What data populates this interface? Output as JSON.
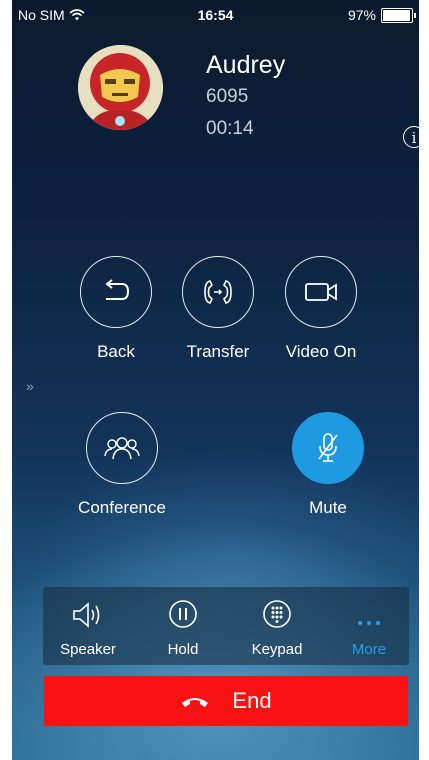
{
  "status_bar": {
    "carrier": "No SIM",
    "time": "16:54",
    "battery": "97%",
    "battery_level": 0.97
  },
  "caller": {
    "name": "Audrey",
    "number": "6095",
    "duration": "00:14"
  },
  "controls": {
    "back": "Back",
    "transfer": "Transfer",
    "video_on": "Video On",
    "conference": "Conference",
    "mute": "Mute"
  },
  "toolbar": {
    "speaker": "Speaker",
    "hold": "Hold",
    "keypad": "Keypad",
    "more": "More"
  },
  "end_button": {
    "label": "End"
  },
  "colors": {
    "accent_blue": "#1e9ae0",
    "end_red": "#f91212"
  }
}
